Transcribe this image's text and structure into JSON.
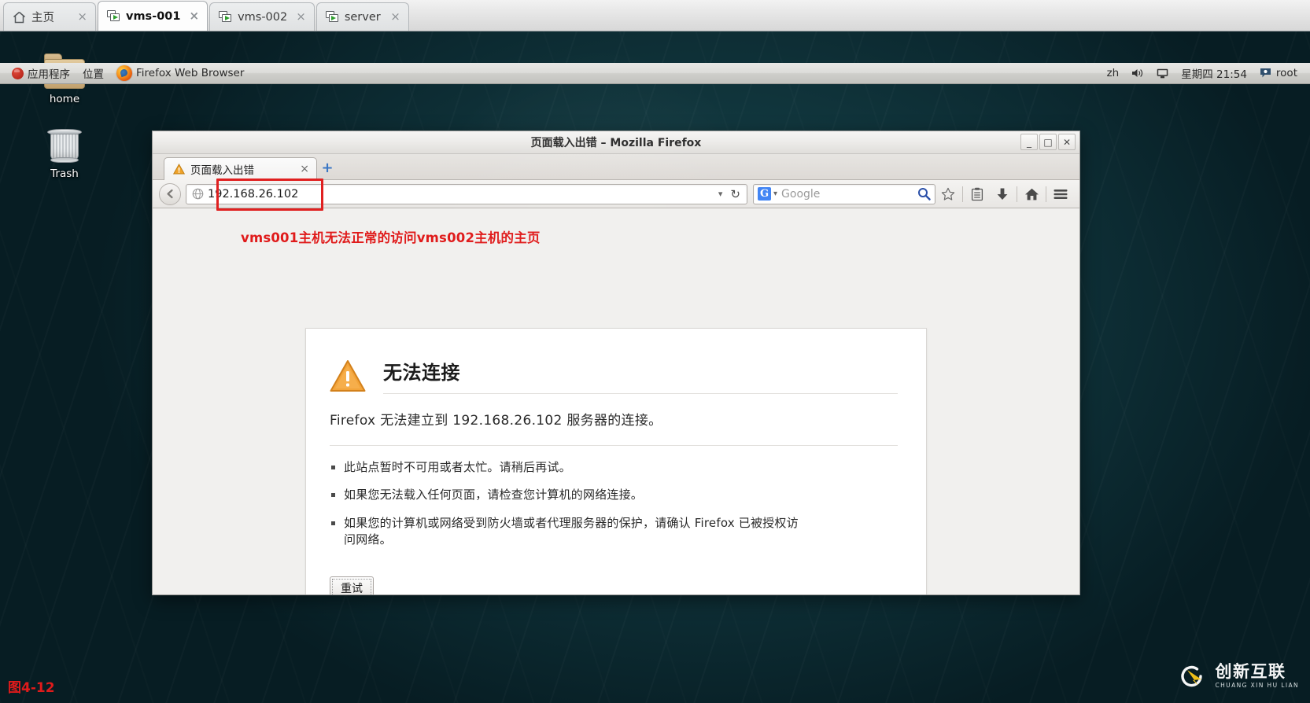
{
  "vm_console": {
    "tabs": [
      {
        "label": "主页",
        "icon": "home-icon",
        "active": false,
        "close": "×"
      },
      {
        "label": "vms-001",
        "icon": "vm-screen-icon",
        "active": true,
        "close": "×"
      },
      {
        "label": "vms-002",
        "icon": "vm-screen-icon",
        "active": false,
        "close": "×"
      },
      {
        "label": "server",
        "icon": "vm-screen-icon",
        "active": false,
        "close": "×"
      }
    ]
  },
  "gnome_panel": {
    "applications": "应用程序",
    "places": "位置",
    "window_title": "Firefox Web Browser",
    "keyboard_layout": "zh",
    "clock": "星期四 21:54",
    "user": "root"
  },
  "desktop": {
    "icons": [
      {
        "label": "home",
        "icon": "home-folder-icon"
      },
      {
        "label": "Trash",
        "icon": "trash-icon"
      }
    ]
  },
  "firefox": {
    "window_title": "页面载入出错  –  Mozilla Firefox",
    "window_buttons": {
      "minimize": "_",
      "maximize": "□",
      "close": "✕"
    },
    "tab": {
      "label": "页面载入出错",
      "close": "×",
      "icon": "warning-icon"
    },
    "new_tab": "+",
    "url": "192.168.26.102",
    "url_dropdown": "▾",
    "reload": "↻",
    "back": "◀",
    "search_engine": "G",
    "search_dropdown": "▾",
    "search_placeholder": "Google",
    "toolbar_buttons": [
      {
        "name": "bookmark-star-button",
        "glyph": "☆"
      },
      {
        "name": "reading-list-button",
        "glyph": "▤"
      },
      {
        "name": "downloads-button",
        "glyph": "⬇"
      },
      {
        "name": "home-button",
        "glyph": "⌂"
      },
      {
        "name": "menu-button",
        "glyph": "≡"
      }
    ],
    "highlight_color": "#e02020"
  },
  "error_page": {
    "annotation": "vms001主机无法正常的访问vms002主机的主页",
    "title": "无法连接",
    "description": "Firefox 无法建立到 192.168.26.102 服务器的连接。",
    "bullets": [
      "此站点暂时不可用或者太忙。请稍后再试。",
      "如果您无法载入任何页面，请检查您计算机的网络连接。",
      "如果您的计算机或网络受到防火墙或者代理服务器的保护，请确认 Firefox 已被授权访问网络。"
    ],
    "retry_button": "重试"
  },
  "figure": {
    "caption": "图4-12"
  },
  "watermark": {
    "cn": "创新互联",
    "en": "CHUANG XIN HU LIAN"
  }
}
